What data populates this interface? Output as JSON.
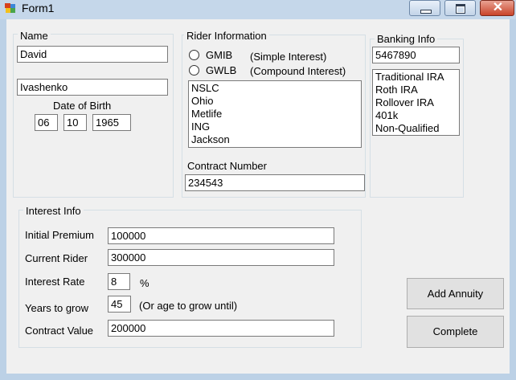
{
  "window": {
    "title": "Form1",
    "close_glyph": "✕",
    "icons": [
      "form-app-icon",
      "minimize-icon",
      "maximize-icon",
      "close-icon"
    ]
  },
  "name_group": {
    "label": "Name",
    "first_name": "David",
    "last_name": "Ivashenko",
    "dob_label": "Date of Birth",
    "dob_month": "06",
    "dob_day": "10",
    "dob_year": "1965"
  },
  "rider_group": {
    "label": "Rider Information",
    "options": [
      {
        "label": "GMIB",
        "note": "(Simple Interest)"
      },
      {
        "label": "GWLB",
        "note": "(Compound Interest)"
      }
    ],
    "carriers": [
      "NSLC",
      "Ohio",
      "Metlife",
      "ING",
      "Jackson"
    ],
    "contract_label": "Contract Number",
    "contract_number": "234543"
  },
  "banking_group": {
    "label": "Banking Info",
    "account": "5467890",
    "account_types": [
      "Traditional IRA",
      "Roth IRA",
      "Rollover IRA",
      "401k",
      "Non-Qualified"
    ]
  },
  "interest_group": {
    "label": "Interest Info",
    "initial_premium_label": "Initial Premium",
    "initial_premium": "100000",
    "current_rider_label": "Current Rider",
    "current_rider": "300000",
    "interest_rate_label": "Interest Rate",
    "interest_rate": "8",
    "percent_sign": "%",
    "years_label": "Years to grow",
    "years": "45",
    "years_note": "(Or age to grow until)",
    "contract_value_label": "Contract Value",
    "contract_value": "200000"
  },
  "buttons": {
    "add_annuity": "Add Annuity",
    "complete": "Complete"
  }
}
